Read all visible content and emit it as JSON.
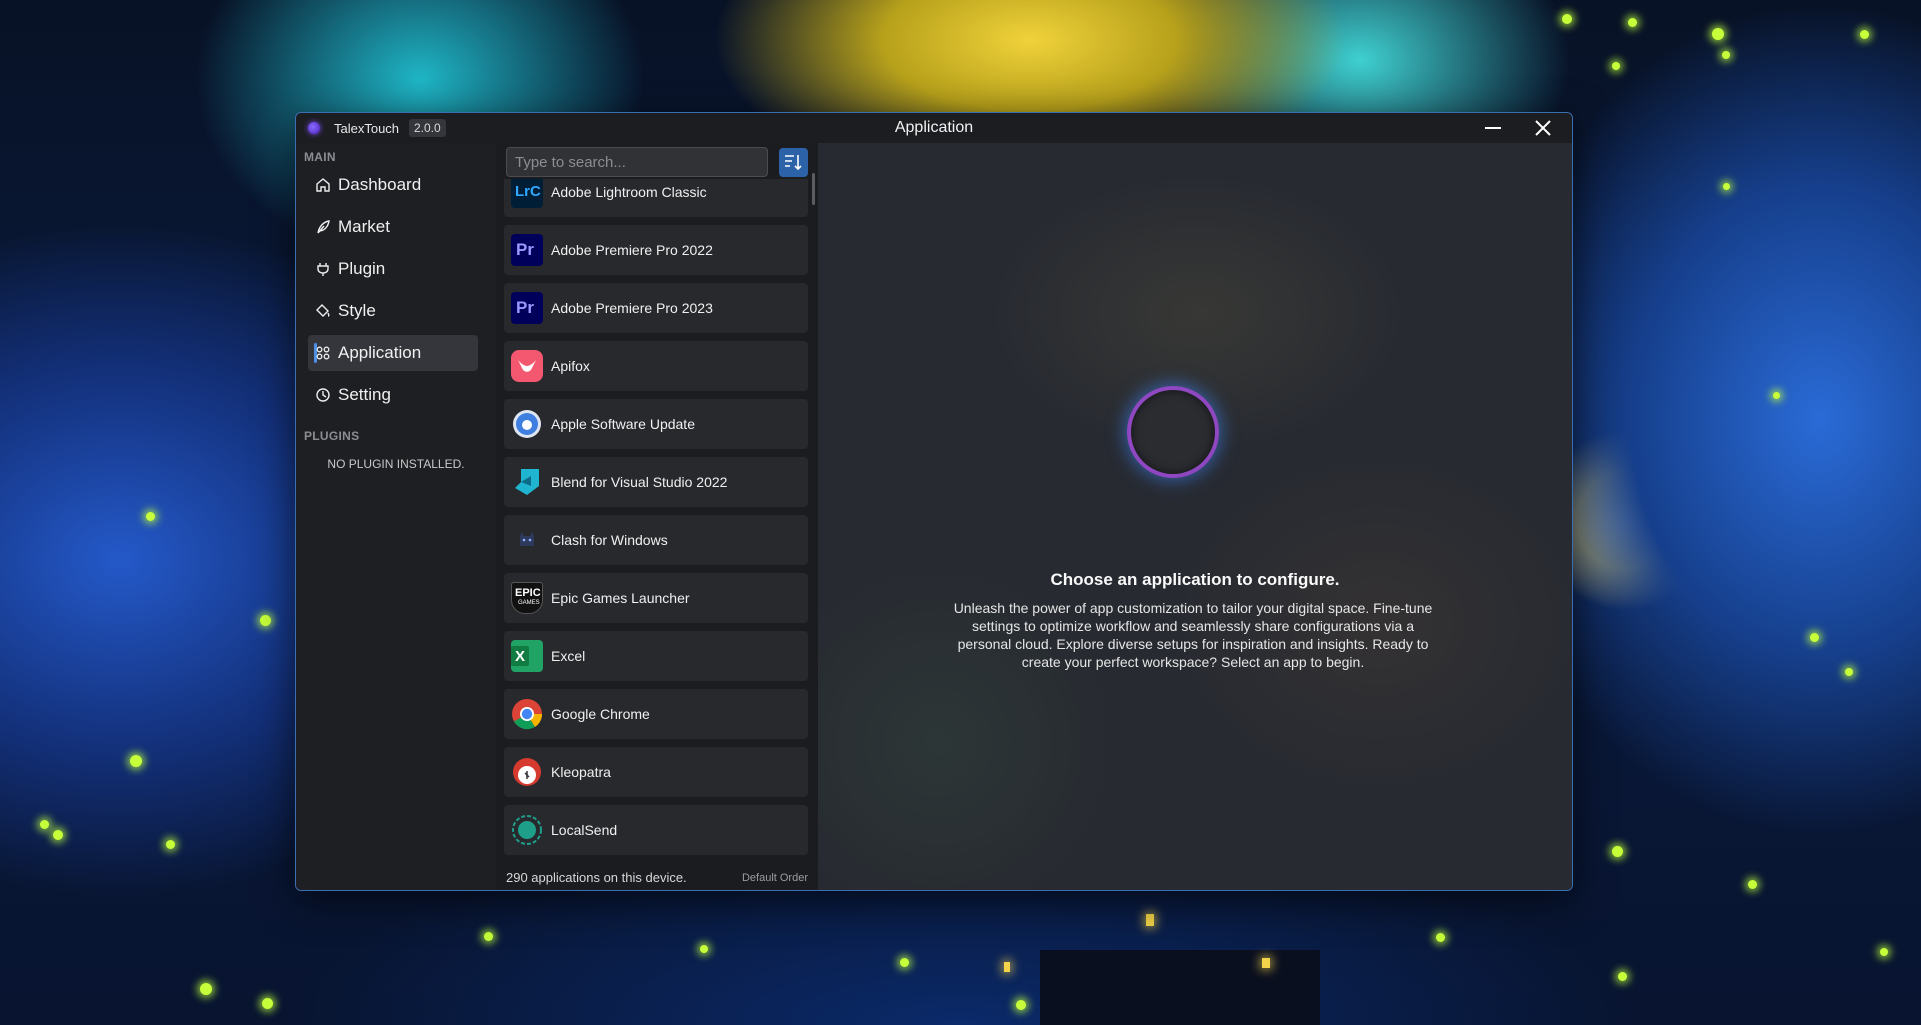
{
  "window": {
    "app_name": "TalexTouch",
    "version": "2.0.0",
    "title": "Application",
    "minimize_icon": "minimize-icon",
    "close_icon": "close-icon"
  },
  "sidebar": {
    "main_label": "MAIN",
    "items": [
      {
        "label": "Dashboard",
        "icon": "home-icon"
      },
      {
        "label": "Market",
        "icon": "feather-icon"
      },
      {
        "label": "Plugin",
        "icon": "plug-icon"
      },
      {
        "label": "Style",
        "icon": "paint-bucket-icon"
      },
      {
        "label": "Application",
        "icon": "grid-icon",
        "active": true
      },
      {
        "label": "Setting",
        "icon": "clock-icon"
      }
    ],
    "plugins_label": "PLUGINS",
    "no_plugin_text": "NO PLUGIN INSTALLED."
  },
  "app_list": {
    "search_placeholder": "Type to search...",
    "sort_icon": "sort-icon",
    "apps": [
      {
        "name": "Adobe Lightroom Classic",
        "icon": "lightroom-icon",
        "icon_text": "LrC",
        "color": "#31a8ff"
      },
      {
        "name": "Adobe Premiere Pro 2022",
        "icon": "premiere-icon",
        "icon_text": "Pr",
        "color": "#9999ff"
      },
      {
        "name": "Adobe Premiere Pro 2023",
        "icon": "premiere-icon",
        "icon_text": "Pr",
        "color": "#9999ff"
      },
      {
        "name": "Apifox",
        "icon": "apifox-icon",
        "color": "#f35870"
      },
      {
        "name": "Apple Software Update",
        "icon": "apple-update-icon",
        "color": "#3f7fe0"
      },
      {
        "name": "Blend for Visual Studio 2022",
        "icon": "blend-icon",
        "color": "#1fb4cf"
      },
      {
        "name": "Clash for Windows",
        "icon": "cat-icon",
        "color": "#4c6fa8"
      },
      {
        "name": "Epic Games Launcher",
        "icon": "epic-games-icon",
        "icon_text": "EPIC",
        "icon_subtext": "GAMES",
        "color": "#111111"
      },
      {
        "name": "Excel",
        "icon": "excel-icon",
        "icon_text": "X",
        "color": "#1f8f4e"
      },
      {
        "name": "Google Chrome",
        "icon": "chrome-icon",
        "color": "#4285f4"
      },
      {
        "name": "Kleopatra",
        "icon": "kleopatra-icon",
        "color": "#d63a2f"
      },
      {
        "name": "LocalSend",
        "icon": "localsend-icon",
        "color": "#1e9f8a"
      }
    ],
    "count_text": "290 applications on this device.",
    "order_text": "Default Order"
  },
  "main": {
    "title": "Choose an application to configure.",
    "description": "Unleash the power of app customization to tailor your digital space. Fine-tune settings to optimize workflow and seamlessly share configurations via a personal cloud. Explore diverse setups for inspiration and insights. Ready to create your perfect workspace? Select an app to begin."
  }
}
